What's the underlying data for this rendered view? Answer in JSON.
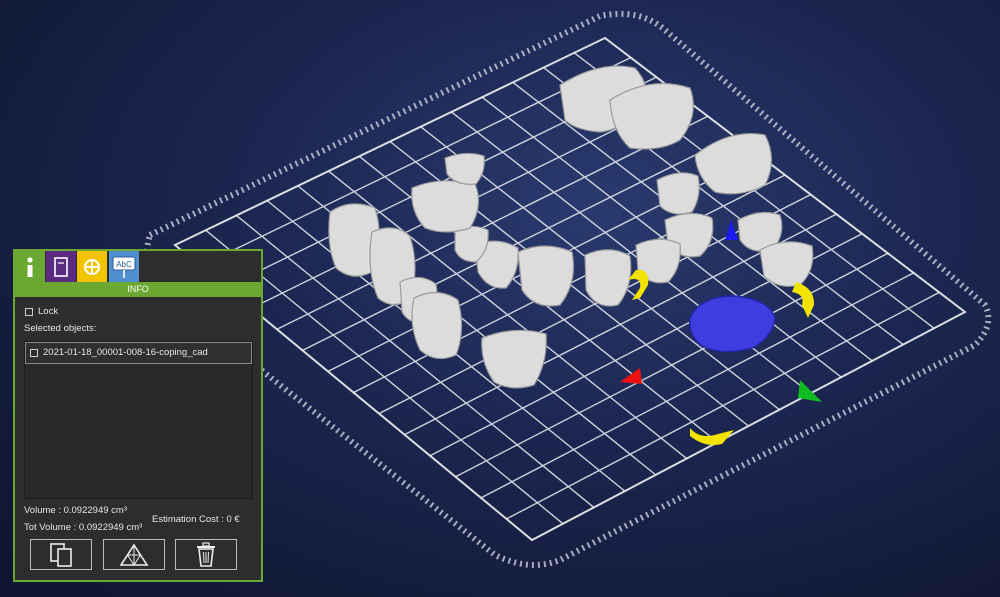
{
  "info_panel": {
    "tabs": [
      {
        "name": "info-icon"
      },
      {
        "name": "book-icon"
      },
      {
        "name": "fx-icon"
      },
      {
        "name": "text-label-icon",
        "text": "AbC"
      }
    ],
    "header": "INFO",
    "lock_label": "Lock",
    "selected_label": "Selected objects:",
    "objects": [
      "2021-01-18_00001-008-16-coping_cad"
    ],
    "volume_label": "Volume : 0.0922949 cm³",
    "tot_volume_label": "Tot Volume : 0.0922949 cm³",
    "estimation_cost_label": "Estimation Cost : 0 €",
    "buttons": [
      {
        "name": "duplicate-icon"
      },
      {
        "name": "mesh-icon"
      },
      {
        "name": "trash-icon"
      }
    ]
  },
  "scene": {
    "build_plate_color": "#ffffff",
    "selected_object_color": "#3d3de0",
    "gizmo_colors": {
      "x": "#ee1111",
      "y": "#11bb22",
      "z": "#1a1aee",
      "rotate": "#f2e400"
    }
  }
}
